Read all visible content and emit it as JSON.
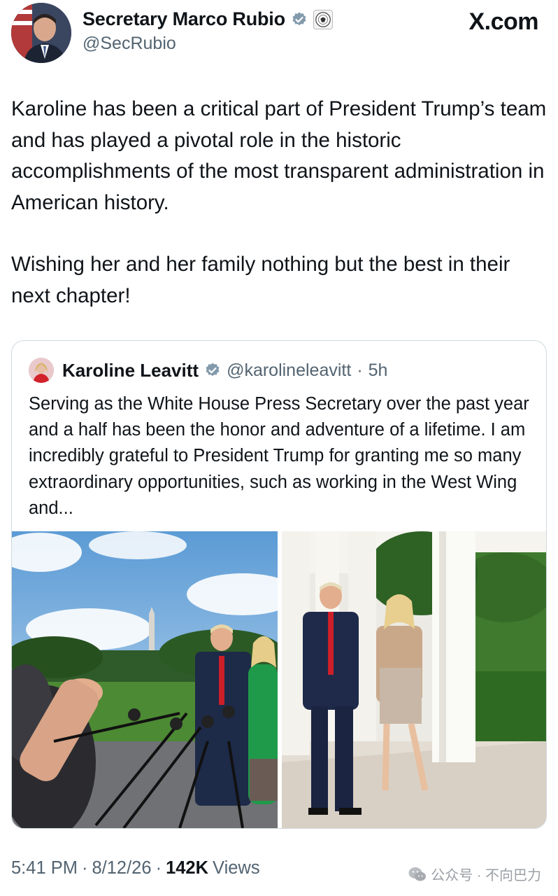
{
  "author": {
    "display_name": "Secretary Marco Rubio",
    "handle": "@SecRubio",
    "verified_icon": "verified-badge-icon",
    "affiliation_icon": "department-seal-icon"
  },
  "brand": "X.com",
  "tweet": {
    "paragraphs": [
      "Karoline has been a critical part of President Trump’s team and has played a pivotal role in the historic accomplishments of the most transparent administration in American history.",
      "Wishing her and her family nothing but the best in their next chapter!"
    ]
  },
  "quote": {
    "display_name": "Karoline Leavitt",
    "handle": "@karolineleavitt",
    "separator": "·",
    "time_ago": "5h",
    "text": "Serving as the White House Press Secretary over the past year and a half has been the honor and adventure of a lifetime. I am incredibly grateful to President Trump for granting me so many extraordinary opportunities, such as working in the West Wing and...",
    "photos": [
      {
        "alt_icon": "press-gaggle-photo"
      },
      {
        "alt_icon": "colonnade-walk-photo"
      }
    ]
  },
  "meta": {
    "time": "5:41 PM",
    "sep1": "·",
    "date": "8/12/26",
    "sep2": "·",
    "views_count": "142K",
    "views_label": "Views"
  },
  "watermark": {
    "text": "公众号 · 不向巴力",
    "icon": "wechat-icon"
  },
  "colors": {
    "verified_blue": "#829aab",
    "text_primary": "#0f1419",
    "text_secondary": "#536471",
    "border": "#cfd9de"
  }
}
